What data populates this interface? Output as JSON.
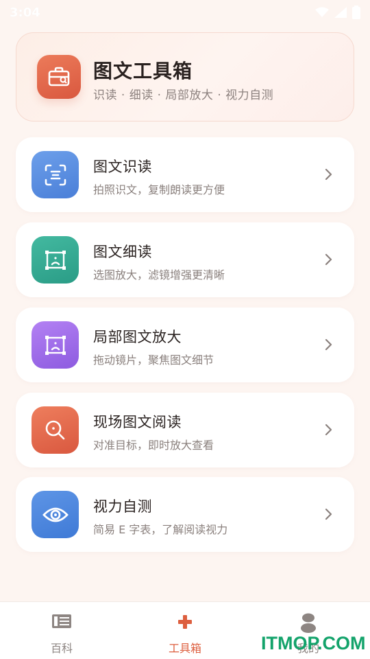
{
  "status_bar": {
    "time": "3:04"
  },
  "header": {
    "title": "图文工具箱",
    "subtitle": "识读 · 细读 · 局部放大 · 视力自测"
  },
  "menu": [
    {
      "title": "图文识读",
      "desc": "拍照识文，复制朗读更方便",
      "icon": "scan-text-icon",
      "color_from": "#6b9ce8",
      "color_to": "#4a7fd8"
    },
    {
      "title": "图文细读",
      "desc": "选图放大，滤镜增强更清晰",
      "icon": "image-frame-icon",
      "color_from": "#3fb59d",
      "color_to": "#2a9c86"
    },
    {
      "title": "局部图文放大",
      "desc": "拖动镜片，聚焦图文细节",
      "icon": "image-frame-icon",
      "color_from": "#b07cf2",
      "color_to": "#8d5be0"
    },
    {
      "title": "现场图文阅读",
      "desc": "对准目标，即时放大查看",
      "icon": "magnifier-icon",
      "color_from": "#ec7b5a",
      "color_to": "#d9583f"
    },
    {
      "title": "视力自测",
      "desc": "简易 E 字表，了解阅读视力",
      "icon": "eye-icon",
      "color_from": "#5b92e4",
      "color_to": "#3f7ad6"
    }
  ],
  "bottom_nav": [
    {
      "label": "百科",
      "icon": "book-icon",
      "active": false
    },
    {
      "label": "工具箱",
      "icon": "plus-cross-icon",
      "active": true
    },
    {
      "label": "我的",
      "icon": "person-icon",
      "active": false
    }
  ],
  "watermark": "ITMOP.COM",
  "colors": {
    "accent": "#dd5f3f",
    "background": "#fdf5f1",
    "watermark": "#13a36b"
  }
}
